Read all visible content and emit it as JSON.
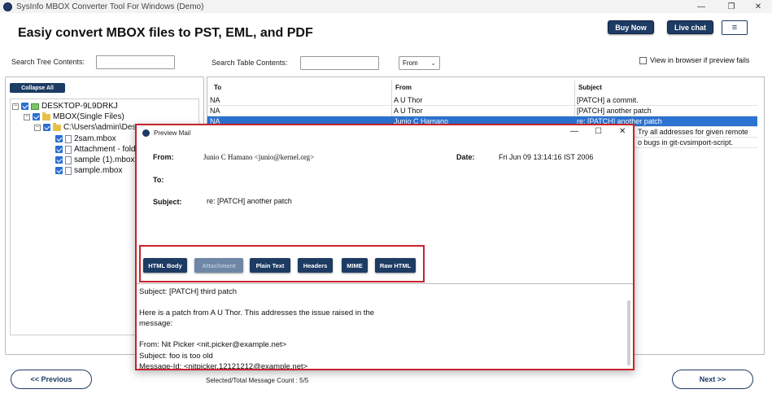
{
  "window": {
    "title": "SysInfo MBOX Converter Tool For Windows (Demo)",
    "minimize": "—",
    "restore": "❐",
    "close": "✕"
  },
  "header": {
    "heading": "Easiy convert MBOX files to PST, EML, and PDF",
    "buy_now": "Buy Now",
    "live_chat": "Live chat",
    "menu_icon": "≡"
  },
  "search": {
    "tree_label": "Search Tree Contents:",
    "table_label": "Search Table Contents:",
    "from_select": "From",
    "view_in_browser": "View in browser if preview fails"
  },
  "tree": {
    "collapse_all": "Collapse All",
    "root": "DESKTOP-9L9DRKJ",
    "mbox_node": "MBOX(Single Files)",
    "path_node": "C:\\Users\\admin\\Des",
    "files": [
      "2sam.mbox",
      "Attachment - fold",
      "sample (1).mbox",
      "sample.mbox"
    ]
  },
  "table": {
    "headers": [
      "To",
      "From",
      "Subject"
    ],
    "rows": [
      {
        "to": "NA",
        "from": "A U Thor",
        "subject": "[PATCH] a commit."
      },
      {
        "to": "NA",
        "from": "A U Thor",
        "subject": "[PATCH] another patch"
      },
      {
        "to": "NA",
        "from": "Junio C Hamano",
        "subject": "re: [PATCH] another patch"
      },
      {
        "to": "",
        "from": "",
        "subject": "Try all addresses for given remote"
      },
      {
        "to": "",
        "from": "",
        "subject": "o bugs in git-cvsimport-script."
      }
    ]
  },
  "footer": {
    "previous": "<< Previous",
    "next": "Next >>",
    "count": "Selected/Total Message Count : 5/5"
  },
  "preview": {
    "title": "Preview Mail",
    "from_label": "From:",
    "from_value": "Junio C Hamano <junio@kernel.org>",
    "date_label": "Date:",
    "date_value": "Fri Jun 09 13:14:16 IST 2006",
    "to_label": "To:",
    "subject_label": "Subject:",
    "subject_value": "re: [PATCH] another patch",
    "tabs": [
      "HTML Body",
      "Attachment",
      "Plain Text",
      "Headers",
      "MIME",
      "Raw HTML"
    ],
    "body_lines": [
      "Subject: [PATCH] third patch",
      "Here is a patch from A U Thor.  This addresses the issue raised in the",
      "message:",
      "From: Nit Picker <nit.picker@example.net>",
      "Subject: foo is too old",
      "Message-Id: <nitpicker.12121212@example.net>"
    ]
  }
}
